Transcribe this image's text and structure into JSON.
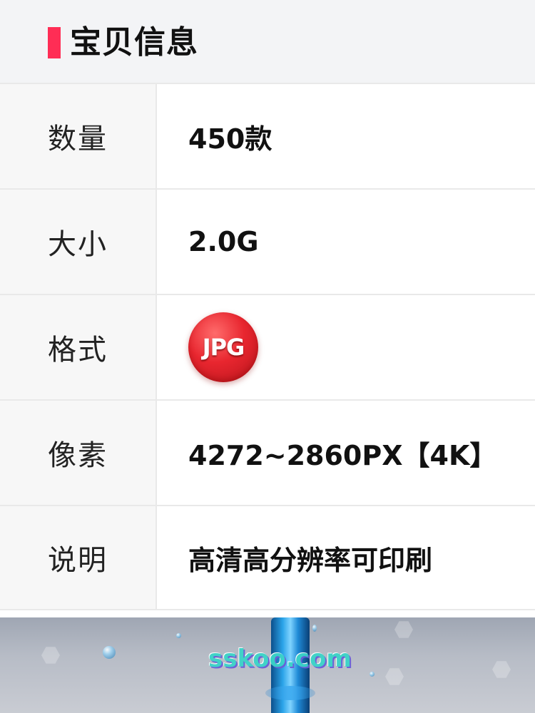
{
  "section": {
    "title": "宝贝信息",
    "accent_color": "#ff2d55"
  },
  "rows": [
    {
      "label": "数量",
      "value": "450款"
    },
    {
      "label": "大小",
      "value": "2.0G"
    },
    {
      "label": "格式",
      "value": "JPG"
    },
    {
      "label": "像素",
      "value": "4272~2860PX【4K】"
    },
    {
      "label": "说明",
      "value": "高清高分辨率可印刷"
    }
  ],
  "preview": {
    "watermark": "sskoo.com"
  }
}
